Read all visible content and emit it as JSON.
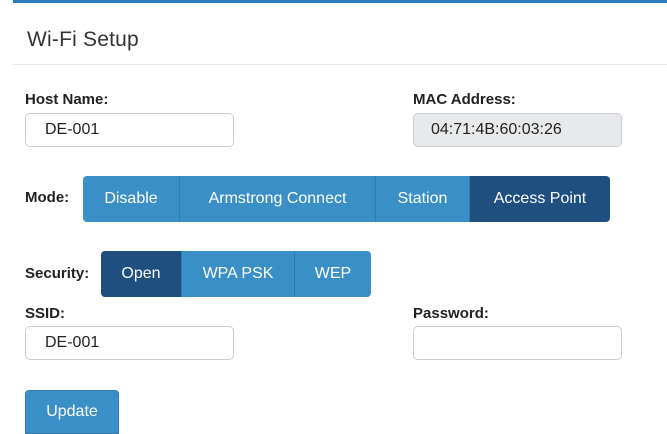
{
  "header": {
    "title": "Wi-Fi Setup"
  },
  "host": {
    "label": "Host Name:",
    "value": "DE-001"
  },
  "mac": {
    "label": "MAC Address:",
    "value": "04:71:4B:60:03:26"
  },
  "mode": {
    "label": "Mode:",
    "options": [
      "Disable",
      "Armstrong Connect",
      "Station",
      "Access Point"
    ],
    "selected": "Access Point"
  },
  "security": {
    "label": "Security:",
    "options": [
      "Open",
      "WPA PSK",
      "WEP"
    ],
    "selected": "Open"
  },
  "ssid": {
    "label": "SSID:",
    "value": "DE-001"
  },
  "password": {
    "label": "Password:",
    "value": ""
  },
  "actions": {
    "update_label": "Update"
  },
  "colors": {
    "accent": "#3a8fc6",
    "active": "#1f4f7e",
    "header_border": "#2b7bbd"
  }
}
